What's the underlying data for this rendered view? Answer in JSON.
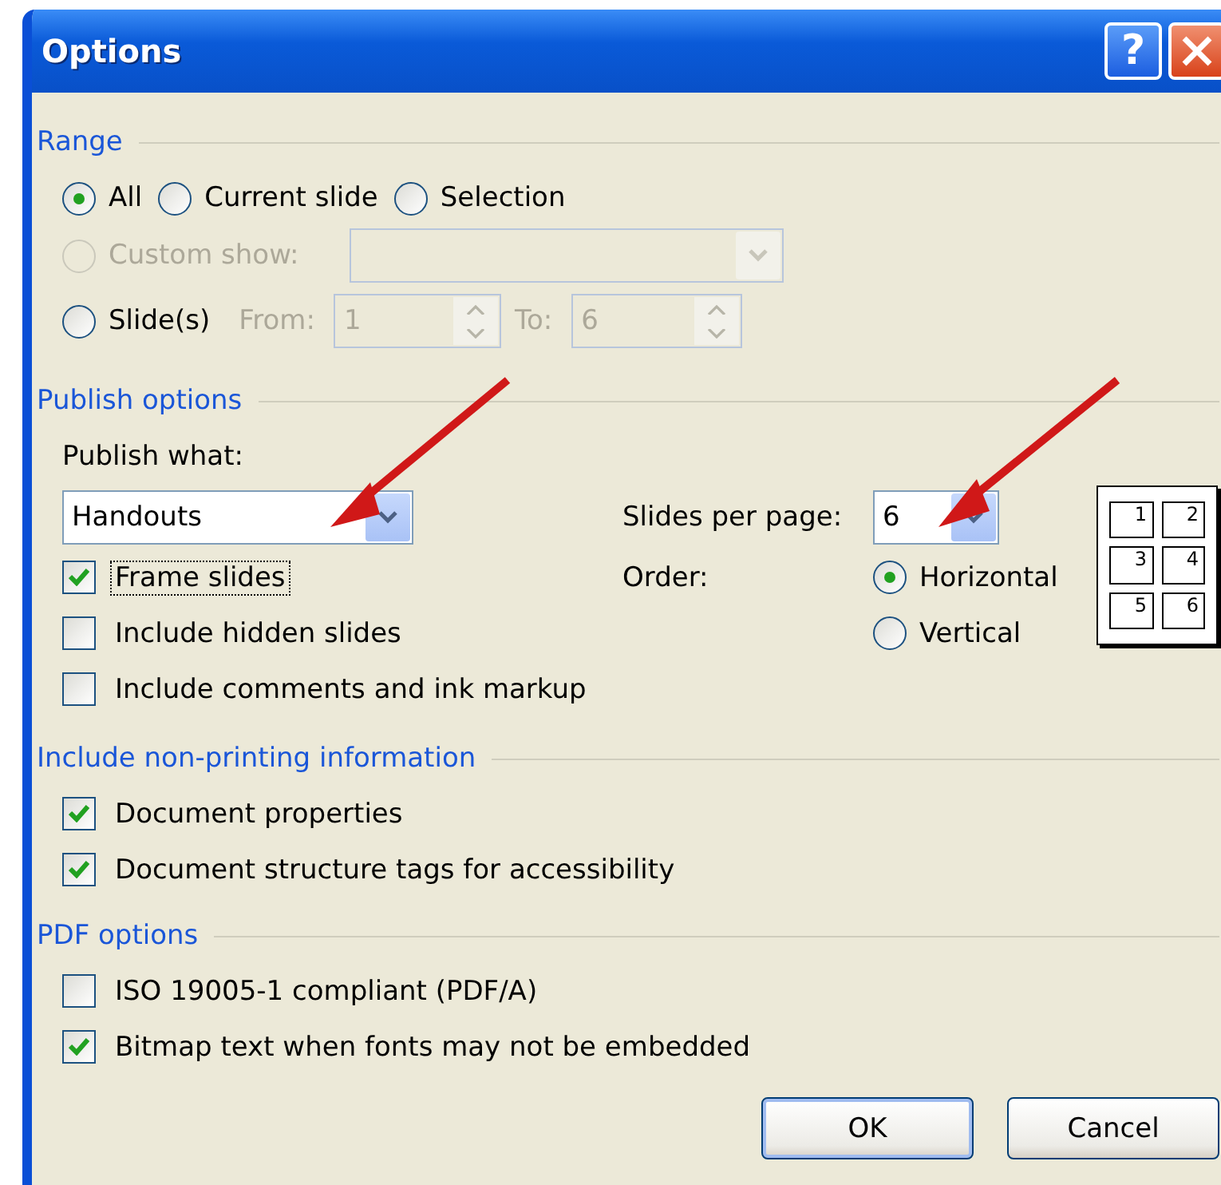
{
  "window": {
    "title": "Options",
    "help_button": "?"
  },
  "range": {
    "title": "Range",
    "options": [
      {
        "label": "All",
        "selected": true
      },
      {
        "label": "Current slide",
        "selected": false
      },
      {
        "label": "Selection",
        "selected": false
      }
    ],
    "custom_show": {
      "label": "Custom show:",
      "selected": false,
      "disabled": true
    },
    "slides": {
      "label": "Slide(s)",
      "selected": false,
      "from_label": "From:",
      "from_value": "1",
      "to_label": "To:",
      "to_value": "6"
    }
  },
  "publish": {
    "title": "Publish options",
    "publish_what_label": "Publish what:",
    "publish_what_value": "Handouts",
    "checkboxes": [
      {
        "label": "Frame slides",
        "checked": true,
        "focused": true
      },
      {
        "label": "Include hidden slides",
        "checked": false,
        "focused": false
      },
      {
        "label": "Include comments and ink markup",
        "checked": false,
        "focused": false
      }
    ],
    "slides_per_page_label": "Slides per page:",
    "slides_per_page_value": "6",
    "order_label": "Order:",
    "order": [
      {
        "label": "Horizontal",
        "selected": true
      },
      {
        "label": "Vertical",
        "selected": false
      }
    ],
    "preview": [
      "1",
      "2",
      "3",
      "4",
      "5",
      "6"
    ]
  },
  "non_printing": {
    "title": "Include non-printing information",
    "checkboxes": [
      {
        "label": "Document properties",
        "checked": true
      },
      {
        "label": "Document structure tags for accessibility",
        "checked": true
      }
    ]
  },
  "pdf": {
    "title": "PDF options",
    "checkboxes": [
      {
        "label": "ISO 19005-1 compliant (PDF/A)",
        "checked": false
      },
      {
        "label": "Bitmap text when fonts may not be embedded",
        "checked": true
      }
    ]
  },
  "buttons": [
    "OK",
    "Cancel"
  ]
}
